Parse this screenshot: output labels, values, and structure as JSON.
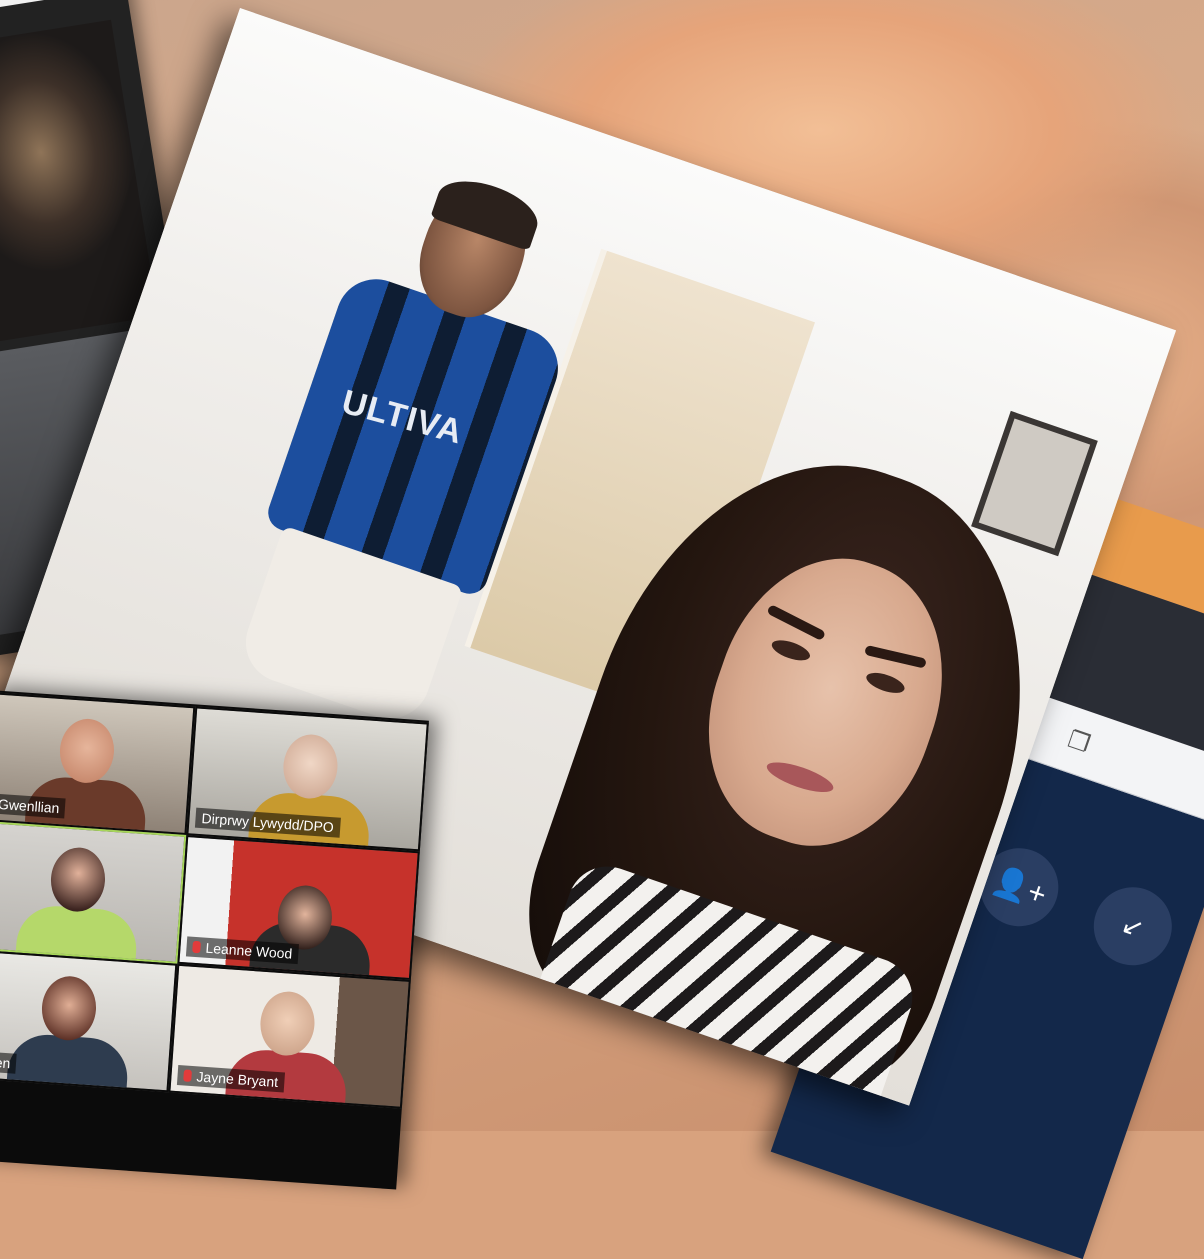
{
  "app_window": {
    "minimize_glyph": "—",
    "restore_glyph": "❐",
    "add_people_glyph": "👤+",
    "share_glyph": "↙"
  },
  "left_frame": {
    "participants_glyph": "👥"
  },
  "main_video": {
    "shirt_sponsor": "ULTIVA"
  },
  "gallery": {
    "tiles": [
      {
        "label": "Gwenllian",
        "active": false,
        "muted": false
      },
      {
        "label": "Dirprwy Lywydd/DPO",
        "active": false,
        "muted": false
      },
      {
        "label": "",
        "active": true,
        "muted": false
      },
      {
        "label": "Leanne Wood",
        "active": false,
        "muted": true
      },
      {
        "label": "yden",
        "active": false,
        "muted": false
      },
      {
        "label": "Jayne Bryant",
        "active": false,
        "muted": true
      }
    ]
  }
}
